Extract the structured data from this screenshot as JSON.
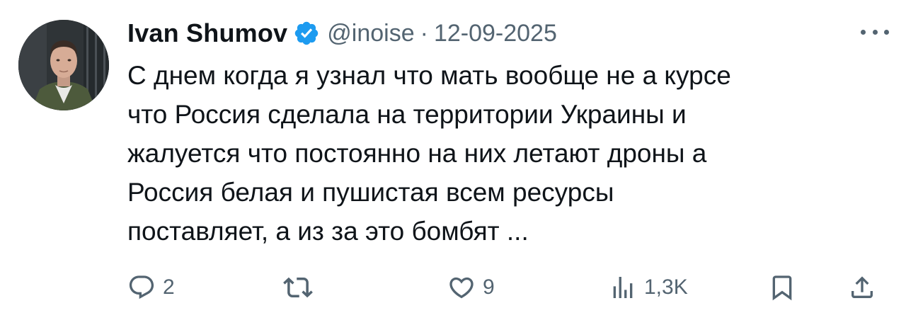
{
  "author": {
    "name": "Ivan Shumov",
    "handle": "@inoise",
    "separator": "·",
    "date": "12-09-2025"
  },
  "tweet": {
    "text": "С днем когда я узнал что мать вообще не а курсе\nчто Россия сделала на территории Украины и\nжалуется что постоянно на них летают дроны а\nРоссия белая и пушистая всем ресурсы\nпоставляет, а из за это бомбят ..."
  },
  "stats": {
    "replies": "2",
    "retweets": "",
    "likes": "9",
    "views": "1,3K"
  },
  "icons": {
    "verified": "verified-badge-icon",
    "more": "more-dots-icon",
    "reply": "reply-icon",
    "retweet": "retweet-icon",
    "like": "heart-icon",
    "views": "views-chart-icon",
    "bookmark": "bookmark-icon",
    "share": "share-icon"
  },
  "colors": {
    "text": "#0f1419",
    "secondary": "#536471",
    "verified": "#1d9bf0"
  }
}
